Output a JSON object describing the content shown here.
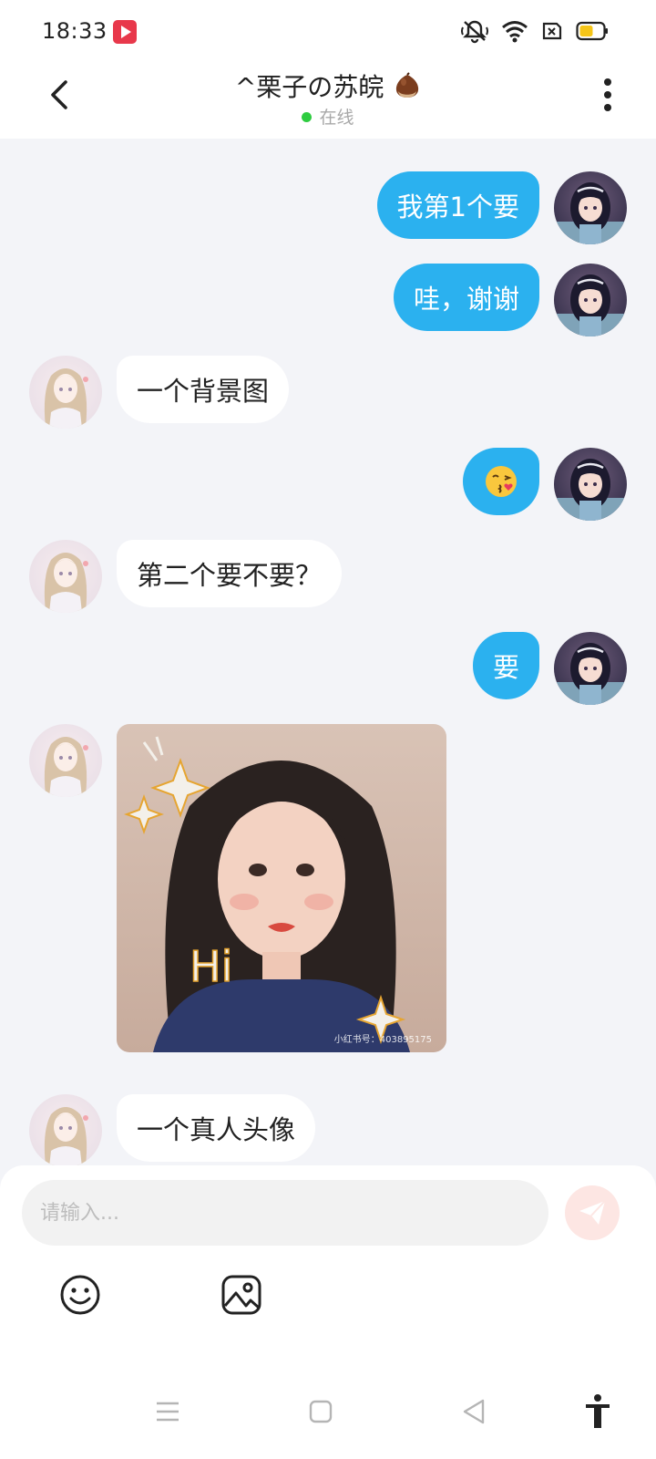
{
  "status_bar": {
    "time": "18:33",
    "icons": [
      "notification-app-icon",
      "mute-bell-icon",
      "wifi-icon",
      "sim-off-icon",
      "battery-icon"
    ]
  },
  "header": {
    "title": "^栗子の苏皖",
    "title_emoji": "chestnut-icon",
    "status_text": "在线",
    "status_color": "#2ecc40"
  },
  "messages": [
    {
      "side": "mine",
      "type": "text",
      "text": "我第1个要"
    },
    {
      "side": "mine",
      "type": "text",
      "text": "哇，谢谢"
    },
    {
      "side": "theirs",
      "type": "text",
      "text": "一个背景图"
    },
    {
      "side": "mine",
      "type": "emoji",
      "emoji": "face-blowing-kiss-icon"
    },
    {
      "side": "theirs",
      "type": "text",
      "text": "第二个要不要？"
    },
    {
      "side": "mine",
      "type": "text",
      "text": "要"
    },
    {
      "side": "theirs",
      "type": "image",
      "overlay_text": "Hi",
      "caption": "小红书号：403895175"
    },
    {
      "side": "theirs",
      "type": "text",
      "text": "一个真人头像"
    }
  ],
  "composer": {
    "placeholder": "请输入...",
    "send_icon": "send-icon",
    "tools": [
      "emoji-icon",
      "image-icon"
    ]
  },
  "nav_bar": [
    "menu-icon",
    "home-icon",
    "back-icon",
    "accessibility-icon"
  ],
  "colors": {
    "accent_bubble": "#2bb1ef",
    "background": "#f3f4f8",
    "send_button": "#fde6e3"
  }
}
